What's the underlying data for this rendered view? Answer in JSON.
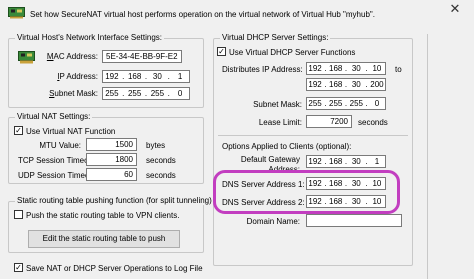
{
  "header": {
    "text": "Set how SecureNAT virtual host performs operation on the virtual network of Virtual Hub \"myhub\".",
    "close": "✕"
  },
  "vhost": {
    "title": "Virtual Host's Network Interface Settings:",
    "mac_label_u": "M",
    "mac_label_rest": "AC Address:",
    "mac_value": "5E-34-4E-BB-9F-E2",
    "ip_label_u": "I",
    "ip_label_rest": "P Address:",
    "ip": [
      "192",
      "168",
      "30",
      "1"
    ],
    "subnet_label_u": "S",
    "subnet_label_rest": "ubnet Mask:",
    "subnet": [
      "255",
      "255",
      "255",
      "0"
    ]
  },
  "vnat": {
    "title": "Virtual NAT Settings:",
    "use_label": "Use Virtual NAT Function",
    "use_checked": true,
    "mtu_label": "MTU Value:",
    "mtu_value": "1500",
    "mtu_unit": "bytes",
    "tcp_label": "TCP Session Timeout:",
    "tcp_value": "1800",
    "tcp_unit": "seconds",
    "udp_label": "UDP Session Timeout:",
    "udp_value": "60",
    "udp_unit": "seconds"
  },
  "routing": {
    "title": "Static routing table pushing function (for split tunneling)",
    "push_label": "Push the static routing table to VPN clients.",
    "push_checked": false,
    "edit_button": "Edit the static routing table to push"
  },
  "log": {
    "label": "Save NAT or DHCP Server Operations to Log File",
    "checked": true
  },
  "dhcp": {
    "title": "Virtual DHCP Server Settings:",
    "use_label": "Use Virtual DHCP Server Functions",
    "use_checked": true,
    "dist_label": "Distributes IP Address:",
    "dist_from": [
      "192",
      "168",
      "30",
      "10"
    ],
    "to_label": "to",
    "dist_to": [
      "192",
      "168",
      "30",
      "200"
    ],
    "subnet_label": "Subnet Mask:",
    "subnet": [
      "255",
      "255",
      "255",
      "0"
    ],
    "lease_label": "Lease Limit:",
    "lease_value": "7200",
    "lease_unit": "seconds",
    "options_title": "Options Applied to Clients (optional):",
    "gateway_label_1": "Default Gateway",
    "gateway_label_2": "Address:",
    "gateway": [
      "192",
      "168",
      "30",
      "1"
    ],
    "dns1_label": "DNS Server Address 1:",
    "dns1": [
      "192",
      "168",
      "30",
      "10"
    ],
    "dns2_label": "DNS Server Address 2:",
    "dns2": [
      "192",
      "168",
      "30",
      "10"
    ],
    "domain_label": "Domain Name:",
    "domain_value": ""
  },
  "colors": {
    "highlight": "#c23ec0"
  }
}
